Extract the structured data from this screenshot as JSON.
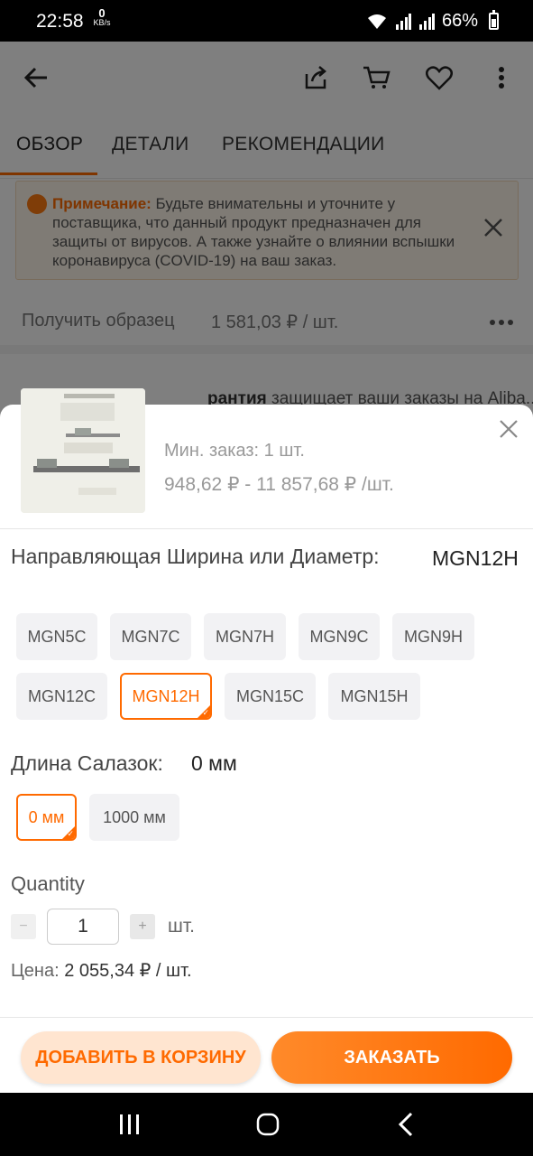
{
  "status": {
    "time": "22:58",
    "net_speed": "0",
    "net_unit": "KB/s",
    "battery": "66%"
  },
  "tabs": [
    "ОБЗОР",
    "ДЕТАЛИ",
    "РЕКОМЕНДАЦИИ"
  ],
  "notice": {
    "label": "Примечание:",
    "text": " Будьте внимательны и уточните у поставщика, что данный продукт предназначен для защиты от вирусов. А также узнайте о влиянии вспышки коронавируса (COVID-19) на ваш заказ."
  },
  "sample": {
    "label": "Получить образец",
    "price": "1 581,03 ₽ / шт."
  },
  "assurance": {
    "bold": "рантия",
    "text": " защищает ваши заказы на Aliba..."
  },
  "sheet": {
    "min_order": "Мин. заказ: 1 шт.",
    "price_range": "948,62 ₽ - 11 857,68 ₽ /шт.",
    "attr1": {
      "title": "Направляющая Ширина или Диаметр:",
      "value": "MGN12H",
      "options": [
        "MGN5C",
        "MGN7C",
        "MGN7H",
        "MGN9C",
        "MGN9H",
        "MGN12C",
        "MGN12H",
        "MGN15C",
        "MGN15H"
      ],
      "selected": "MGN12H"
    },
    "attr2": {
      "title": "Длина Салазок:",
      "value": "0 мм",
      "options": [
        "0 мм",
        "1000 мм"
      ],
      "selected": "0 мм"
    },
    "quantity": {
      "title": "Quantity",
      "minus": "−",
      "plus": "+",
      "value": "1",
      "unit": "шт."
    },
    "price": {
      "label": "Цена:",
      "value": "2 055,34 ₽ / шт."
    },
    "buttons": {
      "add_to_cart": "ДОБАВИТЬ В КОРЗИНУ",
      "order": "ЗАКАЗАТЬ"
    }
  },
  "colors": {
    "accent": "#ff6a00",
    "accent_light": "#ffe5d0"
  }
}
